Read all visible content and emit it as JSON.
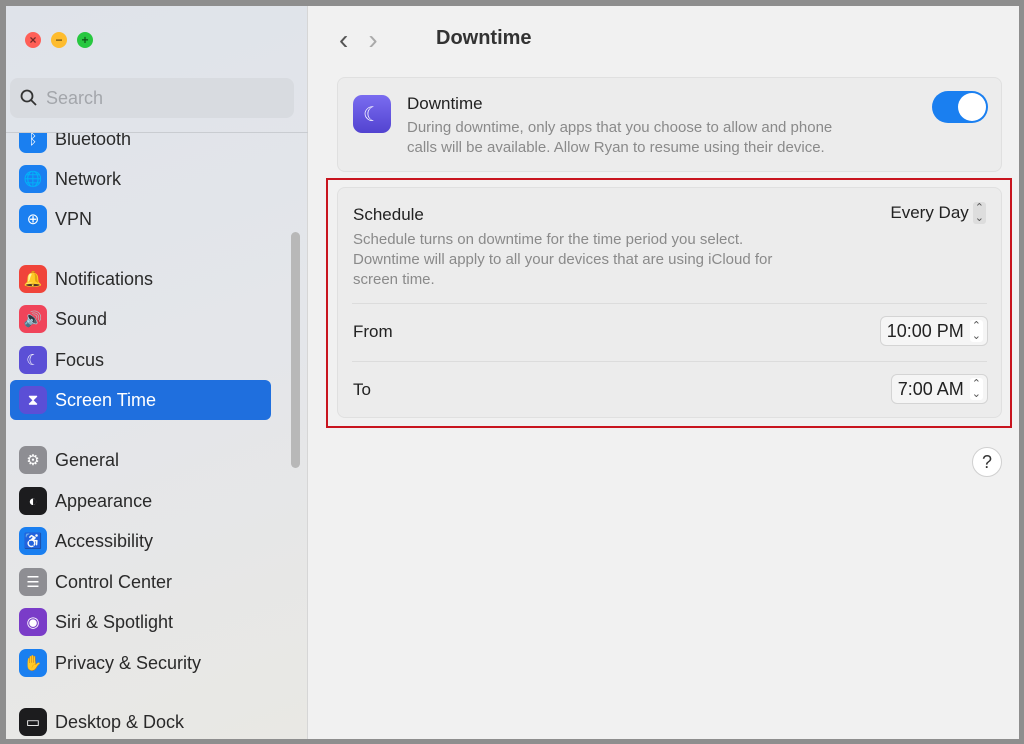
{
  "window": {
    "controls": [
      {
        "name": "close",
        "color": "#ff5f57",
        "glyph": "×"
      },
      {
        "name": "minimize",
        "color": "#febc2e",
        "glyph": "−"
      },
      {
        "name": "zoom",
        "color": "#28c840",
        "glyph": "+"
      }
    ]
  },
  "sidebar": {
    "search_placeholder": "Search",
    "items": [
      {
        "label": "Bluetooth",
        "icon": "bluetooth-icon",
        "color": "#1a7ff0",
        "glyph": "ᛒ"
      },
      {
        "label": "Network",
        "icon": "globe-icon",
        "color": "#1a7ff0",
        "glyph": "🌐"
      },
      {
        "label": "VPN",
        "icon": "vpn-globe-icon",
        "color": "#1a7ff0",
        "glyph": "⊕"
      },
      {
        "label": "Notifications",
        "icon": "bell-icon",
        "color": "#f0443a",
        "glyph": "🔔"
      },
      {
        "label": "Sound",
        "icon": "speaker-icon",
        "color": "#f0445a",
        "glyph": "🔊"
      },
      {
        "label": "Focus",
        "icon": "moon-icon",
        "color": "#5b4fd6",
        "glyph": "☾"
      },
      {
        "label": "Screen Time",
        "icon": "hourglass-icon",
        "color": "#5b4fd6",
        "glyph": "⧗",
        "selected": true
      },
      {
        "label": "General",
        "icon": "gear-icon",
        "color": "#8e8e93",
        "glyph": "⚙"
      },
      {
        "label": "Appearance",
        "icon": "appearance-icon",
        "color": "#1c1c1e",
        "glyph": "◐"
      },
      {
        "label": "Accessibility",
        "icon": "accessibility-icon",
        "color": "#1a7ff0",
        "glyph": "♿"
      },
      {
        "label": "Control Center",
        "icon": "toggles-icon",
        "color": "#8e8e93",
        "glyph": "☰"
      },
      {
        "label": "Siri & Spotlight",
        "icon": "siri-icon",
        "color": "#7a3cc8",
        "glyph": "◉"
      },
      {
        "label": "Privacy & Security",
        "icon": "hand-icon",
        "color": "#1a7ff0",
        "glyph": "✋"
      },
      {
        "label": "Desktop & Dock",
        "icon": "dock-icon",
        "color": "#1c1c1e",
        "glyph": "▭"
      }
    ]
  },
  "main": {
    "back": "‹",
    "forward": "›",
    "title": "Downtime",
    "downtime": {
      "title": "Downtime",
      "description_1": "During downtime, only apps that you choose to allow and phone",
      "description_2": "calls will be available. Allow Ryan to resume using their device.",
      "enabled": true,
      "accent": "#1a7ff0"
    },
    "schedule": {
      "title": "Schedule",
      "value": "Every Day",
      "description_1": "Schedule turns on downtime for the time period you select.",
      "description_2": "Downtime will apply to all your devices that are using iCloud for",
      "description_3": "screen time."
    },
    "from": {
      "label": "From",
      "value": "10:00 PM"
    },
    "to": {
      "label": "To",
      "value": "7:00 AM"
    },
    "help": "?",
    "highlight_color": "#c8141e"
  }
}
